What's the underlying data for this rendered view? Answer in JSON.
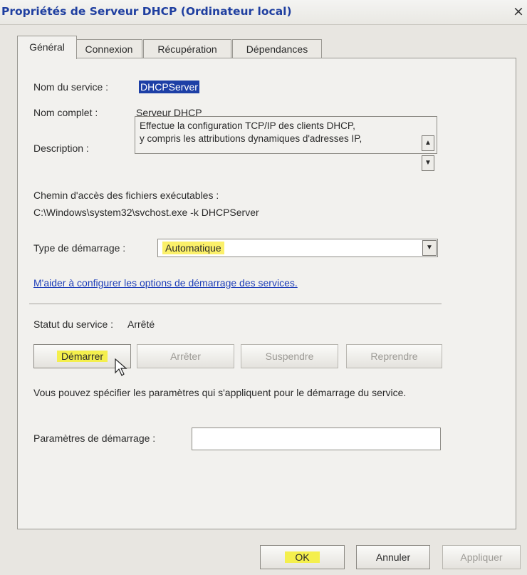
{
  "window": {
    "title": "Propriétés de Serveur DHCP (Ordinateur local)",
    "close_glyph": "×"
  },
  "tabs": [
    {
      "label": "Général"
    },
    {
      "label": "Connexion"
    },
    {
      "label": "Récupération"
    },
    {
      "label": "Dépendances"
    }
  ],
  "general": {
    "service_name_label": "Nom du service :",
    "service_name_value": "DHCPServer",
    "display_name_label": "Nom complet :",
    "display_name_value": "Serveur DHCP",
    "description_label": "Description :",
    "description_line1": "Effectue la configuration TCP/IP des clients DHCP,",
    "description_line2": "y compris les attributions dynamiques d'adresses IP,",
    "path_label": "Chemin d'accès des fichiers exécutables :",
    "path_value": "C:\\Windows\\system32\\svchost.exe -k DHCPServer",
    "startup_type_label": "Type de démarrage :",
    "startup_type_value": "Automatique",
    "help_link": "M'aider à configurer les options de démarrage des services.",
    "status_label": "Statut du service :",
    "status_value": "Arrêté",
    "buttons": {
      "start": "Démarrer",
      "stop": "Arrêter",
      "pause": "Suspendre",
      "resume": "Reprendre"
    },
    "params_hint": "Vous pouvez spécifier les paramètres qui s'appliquent pour le démarrage du service.",
    "params_label": "Paramètres de démarrage :",
    "params_value": ""
  },
  "footer": {
    "ok": "OK",
    "cancel": "Annuler",
    "apply": "Appliquer"
  },
  "colors": {
    "title_text": "#1f3fa0",
    "highlight": "#f4ef4d",
    "selection": "#1d3fa6",
    "link": "#1e3eb8"
  },
  "icons": {
    "scroll_up": "▲",
    "scroll_down": "▼",
    "dropdown": "▼"
  }
}
